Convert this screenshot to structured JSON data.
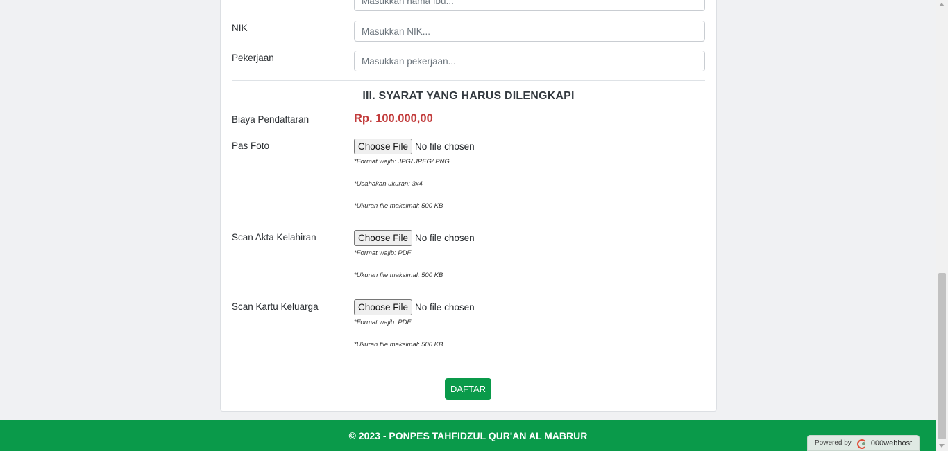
{
  "form": {
    "ibu_placeholder": "Masukkan nama Ibu...",
    "nik_label": "NIK",
    "nik_placeholder": "Masukkan NIK...",
    "pekerjaan_label": "Pekerjaan",
    "pekerjaan_placeholder": "Masukkan pekerjaan...",
    "section_title": "III. SYARAT YANG HARUS DILENGKAPI",
    "biaya_label": "Biaya Pendaftaran",
    "biaya_value": "Rp. 100.000,00",
    "uploads": [
      {
        "label": "Pas Foto",
        "button": "Choose File",
        "status": "No file chosen",
        "notes": [
          "*Format wajib: JPG/ JPEG/ PNG",
          "*Usahakan ukuran: 3x4",
          "*Ukuran file maksimal: 500 KB"
        ]
      },
      {
        "label": "Scan Akta Kelahiran",
        "button": "Choose File",
        "status": "No file chosen",
        "notes": [
          "*Format wajib: PDF",
          "*Ukuran file maksimal: 500 KB"
        ]
      },
      {
        "label": "Scan Kartu Keluarga",
        "button": "Choose File",
        "status": "No file chosen",
        "notes": [
          "*Format wajib: PDF",
          "*Ukuran file maksimal: 500 KB"
        ]
      }
    ],
    "submit_label": "DAFTAR"
  },
  "footer": {
    "text": "© 2023 - PONPES TAHFIDZUL QUR'AN AL MABRUR"
  },
  "badge": {
    "prefix": "Powered by",
    "brand": "000webhost"
  },
  "colors": {
    "brand_green": "#0a9a4a",
    "fee_red": "#c23b3b"
  }
}
